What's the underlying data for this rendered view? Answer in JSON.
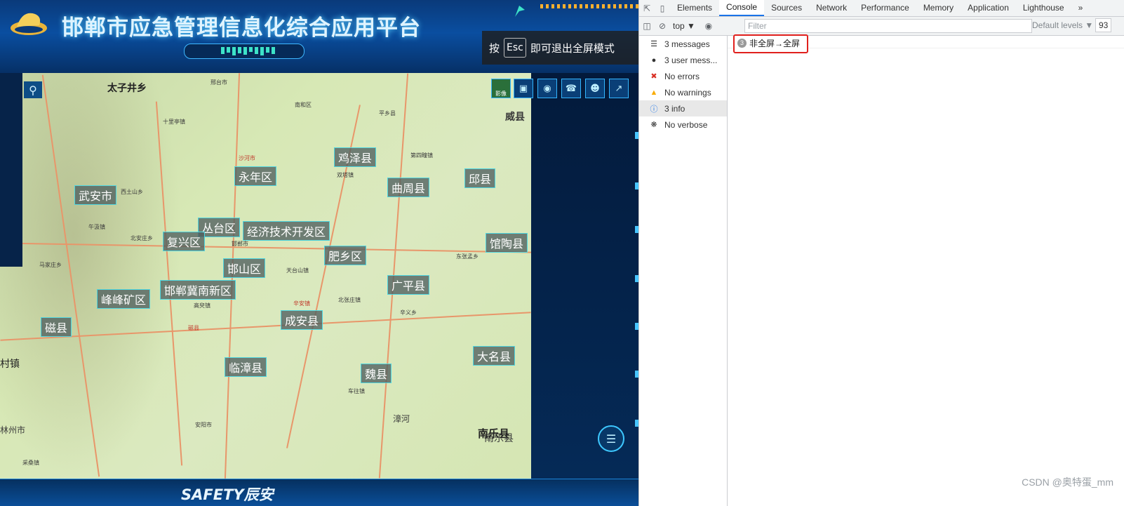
{
  "app": {
    "title": "邯郸市应急管理信息化综合应用平台",
    "fullscreen_tip": {
      "prefix": "按",
      "key": "Esc",
      "suffix": "即可退出全屏模式"
    },
    "footer_brand": "SAFETY辰安",
    "image_toggle_label": "影像",
    "map_labels": [
      "太子井乡",
      "鸡泽县",
      "永年区",
      "曲周县",
      "邱县",
      "武安市",
      "丛台区",
      "经济技术开发区",
      "复兴区",
      "肥乡区",
      "馆陶县",
      "邯山区",
      "广平县",
      "峰峰矿区",
      "邯郸冀南新区",
      "成安县",
      "磁县",
      "临漳县",
      "魏县",
      "大名县",
      "南乐县"
    ],
    "map_places": [
      "邢台市",
      "南和区",
      "平乡县",
      "威县",
      "十里亭镇",
      "沙河市",
      "双塔镇",
      "第四疃镇",
      "西土山乡",
      "午汲镇",
      "北安庄乡",
      "邯郸市",
      "东张孟乡",
      "马家庄乡",
      "天台山镇",
      "高臾镇",
      "辛安镇",
      "北张庄镇",
      "磁县",
      "辛义乡",
      "车往镇",
      "安阳市",
      "南乐县",
      "林州市",
      "采桑镇",
      "漳河"
    ],
    "left_edge_text": "村镇",
    "icons": [
      "logo-icon",
      "search-icon",
      "briefcase-icon",
      "camera-icon",
      "radio-icon",
      "person-icon",
      "measure-icon",
      "layers-icon"
    ]
  },
  "devtools": {
    "tabs": [
      "Elements",
      "Console",
      "Sources",
      "Network",
      "Performance",
      "Memory",
      "Application",
      "Lighthouse"
    ],
    "active_tab": "Console",
    "more": "»",
    "context": "top ▼",
    "filter_placeholder": "Filter",
    "levels": "Default levels ▼",
    "hidden_count": "93",
    "sidebar": [
      {
        "label": "3 messages",
        "icon": "list-icon"
      },
      {
        "label": "3 user mess...",
        "icon": "user-icon"
      },
      {
        "label": "No errors",
        "icon": "error-icon",
        "color": "#d93025"
      },
      {
        "label": "No warnings",
        "icon": "warning-icon",
        "color": "#f9ab00"
      },
      {
        "label": "3 info",
        "icon": "info-icon",
        "color": "#1a73e8"
      },
      {
        "label": "No verbose",
        "icon": "bug-icon"
      }
    ],
    "console_message": {
      "count": "3",
      "text": "非全屏→全屏"
    }
  },
  "watermark": "CSDN @奥特蛋_mm"
}
